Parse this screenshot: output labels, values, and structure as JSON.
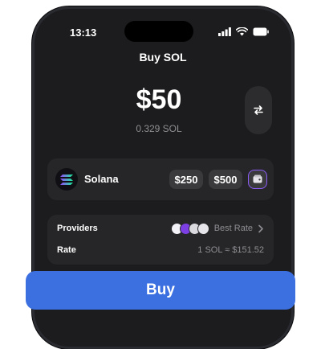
{
  "status_bar": {
    "time": "13:13"
  },
  "header": {
    "title": "Buy SOL"
  },
  "amount": {
    "fiat": "$50",
    "crypto": "0.329 SOL"
  },
  "asset": {
    "name": "Solana"
  },
  "quick_amounts": [
    "$250",
    "$500"
  ],
  "providers": {
    "label": "Providers",
    "value": "Best Rate"
  },
  "rate": {
    "label": "Rate",
    "value": "1 SOL ≈ $151.52"
  },
  "buy_button": {
    "label": "Buy"
  },
  "colors": {
    "accent": "#3c6fe0",
    "background": "#1c1c1e",
    "card": "#262628"
  }
}
